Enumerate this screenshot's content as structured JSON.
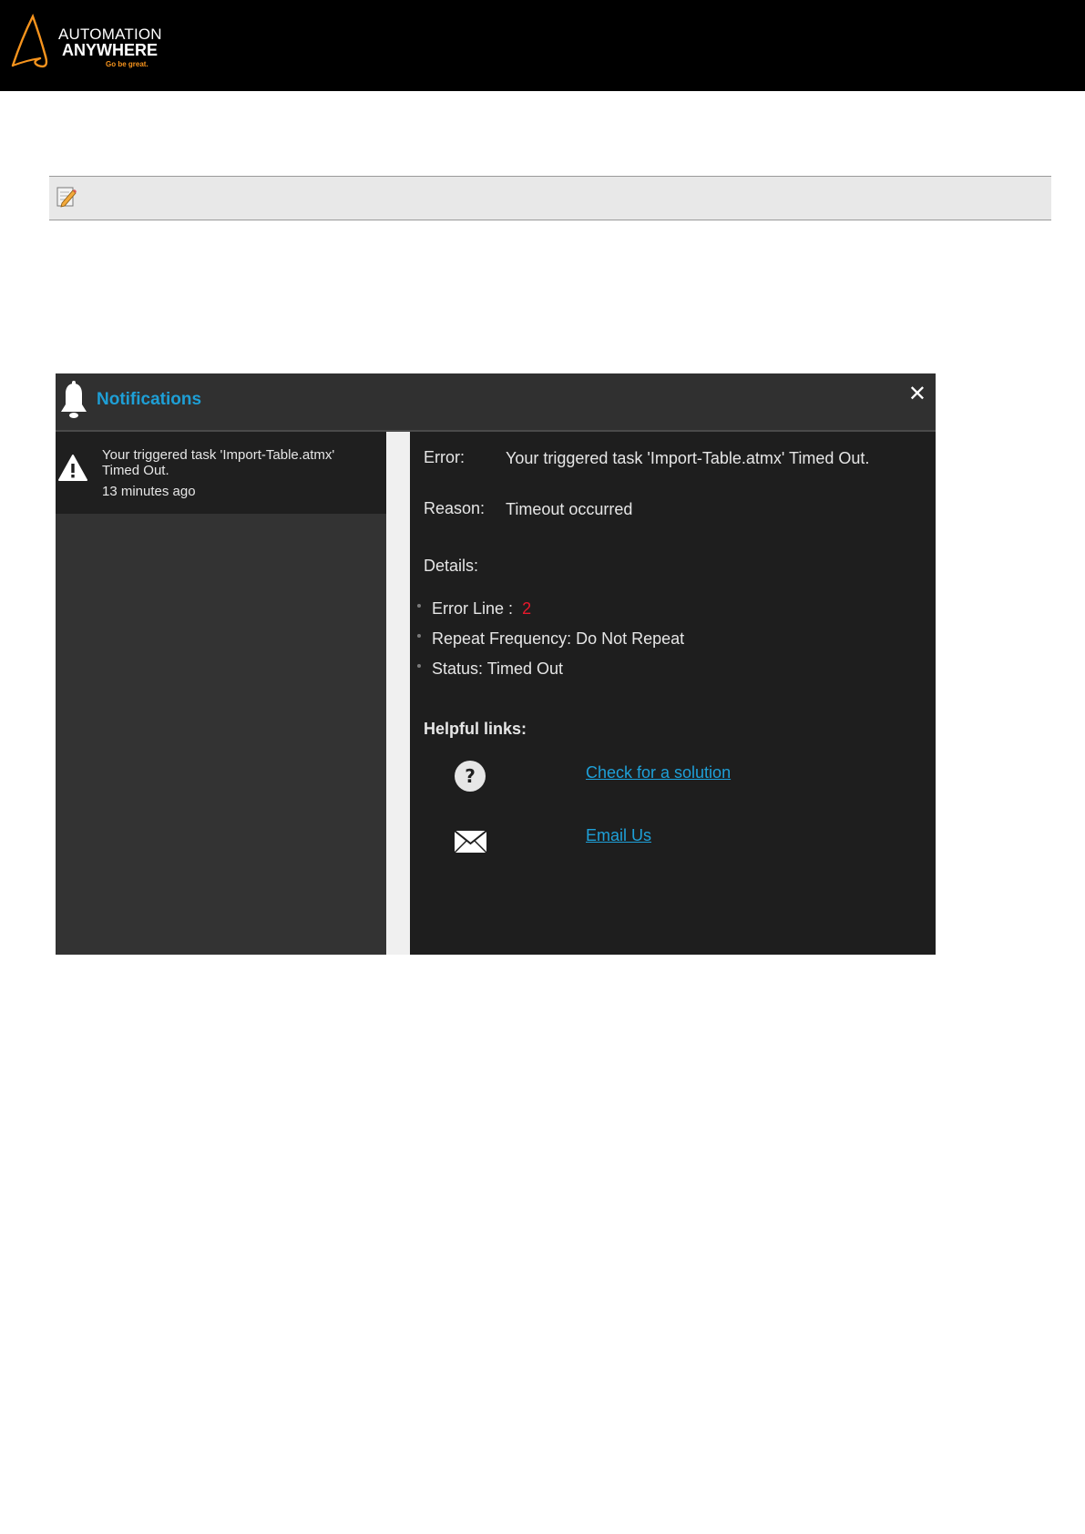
{
  "header": {
    "logo_line1": "AUTOMATION",
    "logo_line2": "ANYWHERE",
    "logo_tagline": "Go be great.",
    "background": "#000000",
    "accent": "#f7941d"
  },
  "note": {
    "icon": "pencil-note-icon"
  },
  "notifications": {
    "title": "Notifications",
    "close_label": "✕",
    "title_color": "#1e9fd6",
    "items": [
      {
        "message": "Your triggered task 'Import-Table.atmx' Timed Out.",
        "time": "13 minutes ago",
        "icon": "warning-icon"
      }
    ],
    "detail": {
      "error_label": "Error:",
      "error_value": "Your triggered task 'Import-Table.atmx' Timed Out.",
      "reason_label": "Reason:",
      "reason_value": "Timeout occurred",
      "details_label": "Details:",
      "details": {
        "error_line_label": "Error Line :",
        "error_line_value": "2",
        "repeat_frequency": "Repeat Frequency: Do Not Repeat",
        "status": "Status: Timed Out"
      },
      "helpful_links_label": "Helpful links:",
      "links": [
        {
          "label": "Check for a solution",
          "icon": "question-icon"
        },
        {
          "label": "Email Us",
          "icon": "envelope-icon"
        }
      ],
      "link_color": "#1ea0d8",
      "error_number_color": "#e8192c"
    }
  }
}
